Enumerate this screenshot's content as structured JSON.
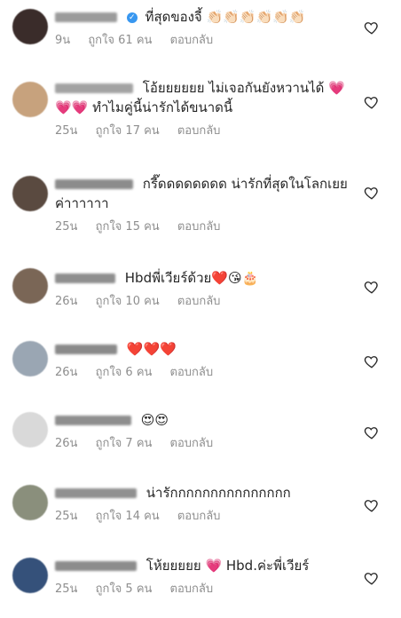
{
  "comments": [
    {
      "username_mask": "p____1_4",
      "verified": true,
      "text": "ที่สุดของจี้ 👏🏻👏🏻👏🏻👏🏻👏🏻👏🏻",
      "time": "9น",
      "likes": "ถูกใจ 61 คน",
      "reply": "ตอบกลับ",
      "avatar_color": "#3a2c2a"
    },
    {
      "username_mask": "l_t____e____",
      "verified": false,
      "text": "โอ้ยยยยยย ไม่เจอกันยังหวานได้ 💗💗💗 ทำไมคู่นี้น่ารักได้ขนาดนี้",
      "time": "25น",
      "likes": "ถูกใจ 17 คน",
      "reply": "ตอบกลับ",
      "avatar_color": "#c7a27d"
    },
    {
      "username_mask": "h__ ____u_t._t",
      "verified": false,
      "text": "กรี๊ดดดดดดดด น่ารักที่สุดในโลกเยยค่าาาาาา",
      "time": "25น",
      "likes": "ถูกใจ 15 คน",
      "reply": "ตอบกลับ",
      "avatar_color": "#5a4a40"
    },
    {
      "username_mask": "i__n___243",
      "verified": false,
      "text": "Hbdพี่เวียร์ด้วย❤️😘🎂",
      "time": "26น",
      "likes": "ถูกใจ 10 คน",
      "reply": "ตอบกลับ",
      "avatar_color": "#7a6656"
    },
    {
      "username_mask": "c_____r__",
      "verified": false,
      "text": "❤️❤️❤️",
      "time": "26น",
      "likes": "ถูกใจ 6 คน",
      "reply": "ตอบกลับ",
      "avatar_color": "#9aa6b3"
    },
    {
      "username_mask": "m_____l_v_b",
      "verified": false,
      "text": "😍😍",
      "time": "26น",
      "likes": "ถูกใจ 7 คน",
      "reply": "ตอบกลับ",
      "avatar_color": "#d9d9d9"
    },
    {
      "username_mask": "t_ _ _y h_t_t_l",
      "verified": false,
      "text": "น่ารักกกกกกกกกกกกกกก",
      "time": "25น",
      "likes": "ถูกใจ 14 คน",
      "reply": "ตอบกลับ",
      "avatar_color": "#8a8f7c"
    },
    {
      "username_mask": "h__ _ _t__p_",
      "verified": false,
      "text": "โห้ยยยยย 💗 Hbd.ค่ะพี่เวียร์",
      "time": "25น",
      "likes": "ถูกใจ 5 คน",
      "reply": "ตอบกลับ",
      "avatar_color": "#35517a"
    }
  ]
}
